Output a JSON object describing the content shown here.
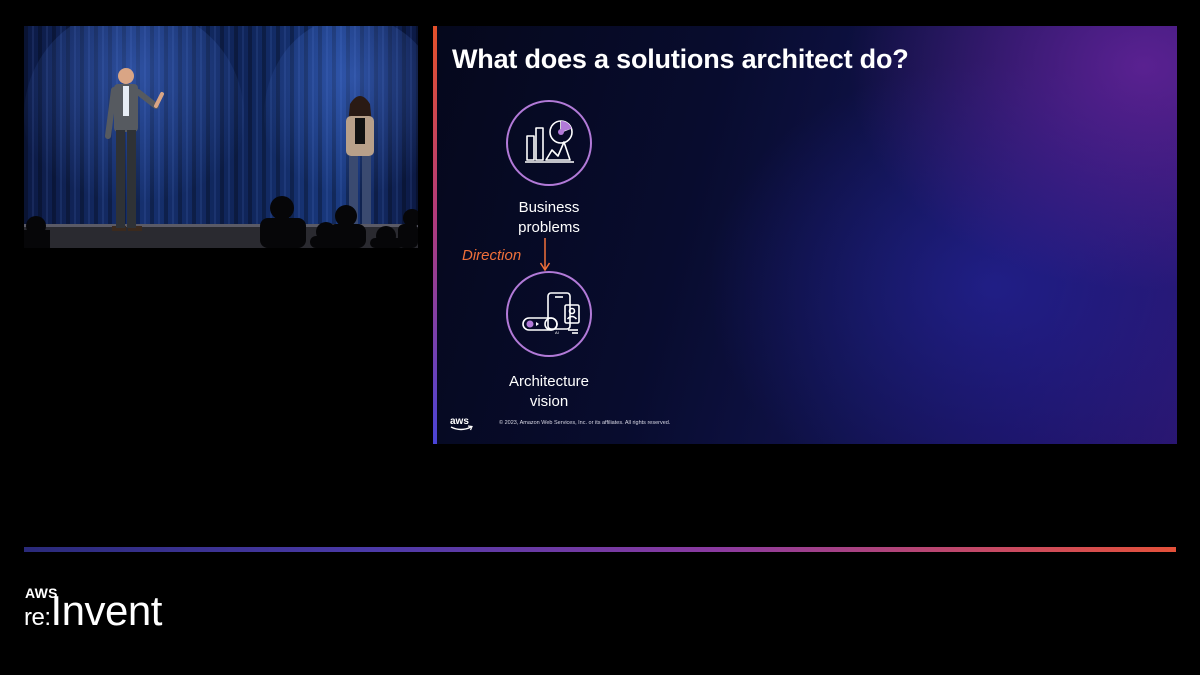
{
  "slide": {
    "title": "What does a solutions architect do?",
    "nodes": [
      {
        "label_line1": "Business",
        "label_line2": "problems",
        "icon": "analytics-charts-icon"
      },
      {
        "label_line1": "Architecture",
        "label_line2": "vision",
        "icon": "devices-architecture-icon"
      }
    ],
    "connector_label": "Direction",
    "footer_logo": "aws",
    "copyright": "© 2023, Amazon Web Services, Inc. or its affiliates. All rights reserved."
  },
  "event": {
    "brand": "AWS",
    "name_prefix": "re:",
    "name": "Invent"
  },
  "colors": {
    "accent_orange": "#f0703a",
    "node_ring": "#b27ad8",
    "bar_start": "#2a2a7a",
    "bar_end": "#e4513a"
  }
}
